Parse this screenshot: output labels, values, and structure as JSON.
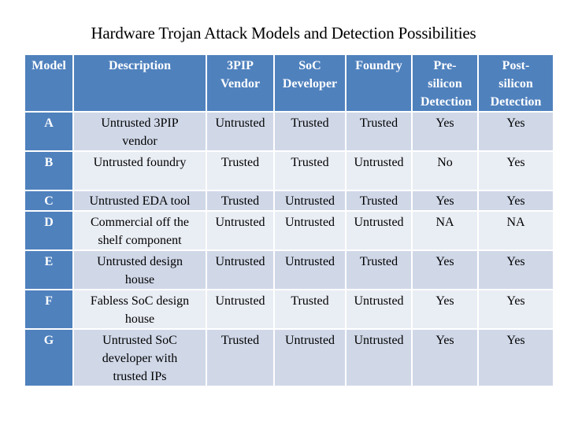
{
  "title": "Hardware Trojan Attack Models and Detection Possibilities",
  "table": {
    "headers": [
      "Model",
      "Description",
      "3PIP Vendor",
      "SoC Developer",
      "Foundry",
      "Pre-silicon Detection",
      "Post-silicon Detection"
    ],
    "rows": [
      {
        "model": "A",
        "description": "Untrusted 3PIP vendor",
        "vendor": "Untrusted",
        "soc": "Trusted",
        "foundry": "Trusted",
        "pre": "Yes",
        "post": "Yes"
      },
      {
        "model": "B",
        "description": "Untrusted foundry",
        "vendor": "Trusted",
        "soc": "Trusted",
        "foundry": "Untrusted",
        "pre": "No",
        "post": "Yes"
      },
      {
        "model": "C",
        "description": "Untrusted EDA tool",
        "vendor": "Trusted",
        "soc": "Untrusted",
        "foundry": "Trusted",
        "pre": "Yes",
        "post": "Yes"
      },
      {
        "model": "D",
        "description": "Commercial off the shelf component",
        "vendor": "Untrusted",
        "soc": "Untrusted",
        "foundry": "Untrusted",
        "pre": "NA",
        "post": "NA"
      },
      {
        "model": "E",
        "description": "Untrusted design house",
        "vendor": "Untrusted",
        "soc": "Untrusted",
        "foundry": "Trusted",
        "pre": "Yes",
        "post": "Yes"
      },
      {
        "model": "F",
        "description": "Fabless SoC design house",
        "vendor": "Untrusted",
        "soc": "Trusted",
        "foundry": "Untrusted",
        "pre": "Yes",
        "post": "Yes"
      },
      {
        "model": "G",
        "description": "Untrusted SoC developer with trusted IPs",
        "vendor": "Trusted",
        "soc": "Untrusted",
        "foundry": "Untrusted",
        "pre": "Yes",
        "post": "Yes"
      }
    ]
  }
}
